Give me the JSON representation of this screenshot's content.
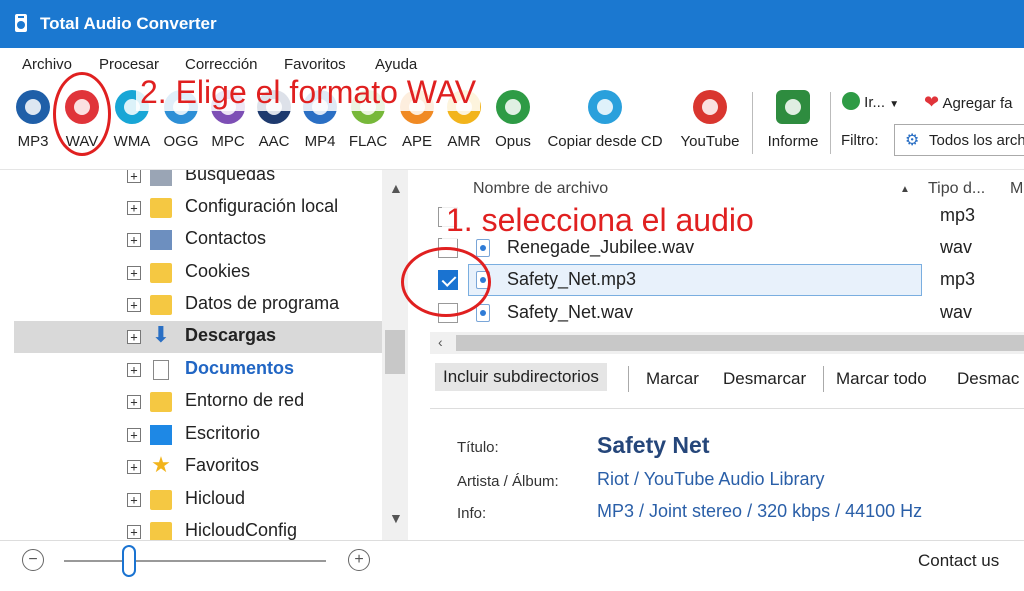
{
  "window": {
    "title": "Total Audio Converter"
  },
  "menu": [
    "Archivo",
    "Procesar",
    "Corrección",
    "Favoritos",
    "Ayuda"
  ],
  "toolbar": {
    "formats": [
      {
        "label": "MP3",
        "color": "#1f5fa8"
      },
      {
        "label": "WAV",
        "color": "#e0343a"
      },
      {
        "label": "WMA",
        "color": "#18a6d6"
      },
      {
        "label": "OGG",
        "color": "#2d8fd6"
      },
      {
        "label": "MPC",
        "color": "#7d4fb5"
      },
      {
        "label": "AAC",
        "color": "#1e3a6e"
      },
      {
        "label": "MP4",
        "color": "#2a6fc4"
      },
      {
        "label": "FLAC",
        "color": "#77b83a"
      },
      {
        "label": "APE",
        "color": "#f08a24"
      },
      {
        "label": "AMR",
        "color": "#f2b41c"
      },
      {
        "label": "Opus",
        "color": "#2e9b45"
      }
    ],
    "copy_cd": "Copiar desde CD",
    "youtube": "YouTube",
    "report": "Informe",
    "goto": "Ir...",
    "add_fav": "Agregar fa",
    "filter_label": "Filtro:",
    "filter_value": "Todos los arch"
  },
  "tree": {
    "items": [
      {
        "label": "Búsquedas",
        "style": "normal"
      },
      {
        "label": "Configuración local",
        "style": "normal"
      },
      {
        "label": "Contactos",
        "style": "normal"
      },
      {
        "label": "Cookies",
        "style": "normal"
      },
      {
        "label": "Datos de programa",
        "style": "normal"
      },
      {
        "label": "Descargas",
        "style": "bold"
      },
      {
        "label": "Documentos",
        "style": "blue"
      },
      {
        "label": "Entorno de red",
        "style": "normal"
      },
      {
        "label": "Escritorio",
        "style": "normal"
      },
      {
        "label": "Favoritos",
        "style": "normal"
      },
      {
        "label": "Hicloud",
        "style": "normal"
      },
      {
        "label": "HicloudConfig",
        "style": "normal"
      }
    ]
  },
  "filelist": {
    "columns": [
      "Nombre de archivo",
      "Tipo d...",
      "M"
    ],
    "rows": [
      {
        "name": "",
        "type": "mp3",
        "checked": false
      },
      {
        "name": "Renegade_Jubilee.wav",
        "type": "wav",
        "checked": false
      },
      {
        "name": "Safety_Net.mp3",
        "type": "mp3",
        "checked": true
      },
      {
        "name": "Safety_Net.wav",
        "type": "wav",
        "checked": false
      }
    ]
  },
  "actions": [
    "Incluir subdirectorios",
    "Marcar",
    "Desmarcar",
    "Marcar todo",
    "Desmac"
  ],
  "info": {
    "title_label": "Título:",
    "title_value": "Safety Net",
    "artist_label": "Artista / Álbum:",
    "artist_value": "Riot / YouTube Audio Library",
    "info_label": "Info:",
    "info_value": "MP3 / Joint stereo / 320 kbps / 44100 Hz"
  },
  "statusbar": {
    "zoom_minus": "−",
    "zoom_plus": "+",
    "contact": "Contact us"
  },
  "annotations": {
    "step1": "1. selecciona el audio",
    "step2": "2. Elige el formato WAV"
  }
}
